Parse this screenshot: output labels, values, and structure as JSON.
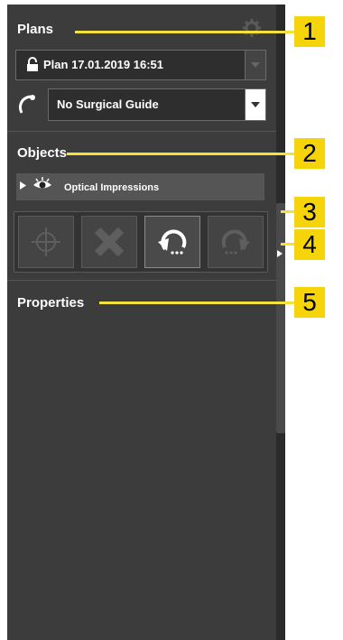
{
  "plans": {
    "title": "Plans",
    "plan_value": "Plan 17.01.2019 16:51",
    "guide_value": "No Surgical Guide"
  },
  "objects": {
    "title": "Objects",
    "items": [
      {
        "label": "Optical Impressions"
      }
    ]
  },
  "properties": {
    "title": "Properties"
  },
  "callouts": [
    "1",
    "2",
    "3",
    "4",
    "5"
  ],
  "colors": {
    "panel_bg": "#3c3c3c",
    "callout": "#f6d40a",
    "text": "#ffffff"
  }
}
